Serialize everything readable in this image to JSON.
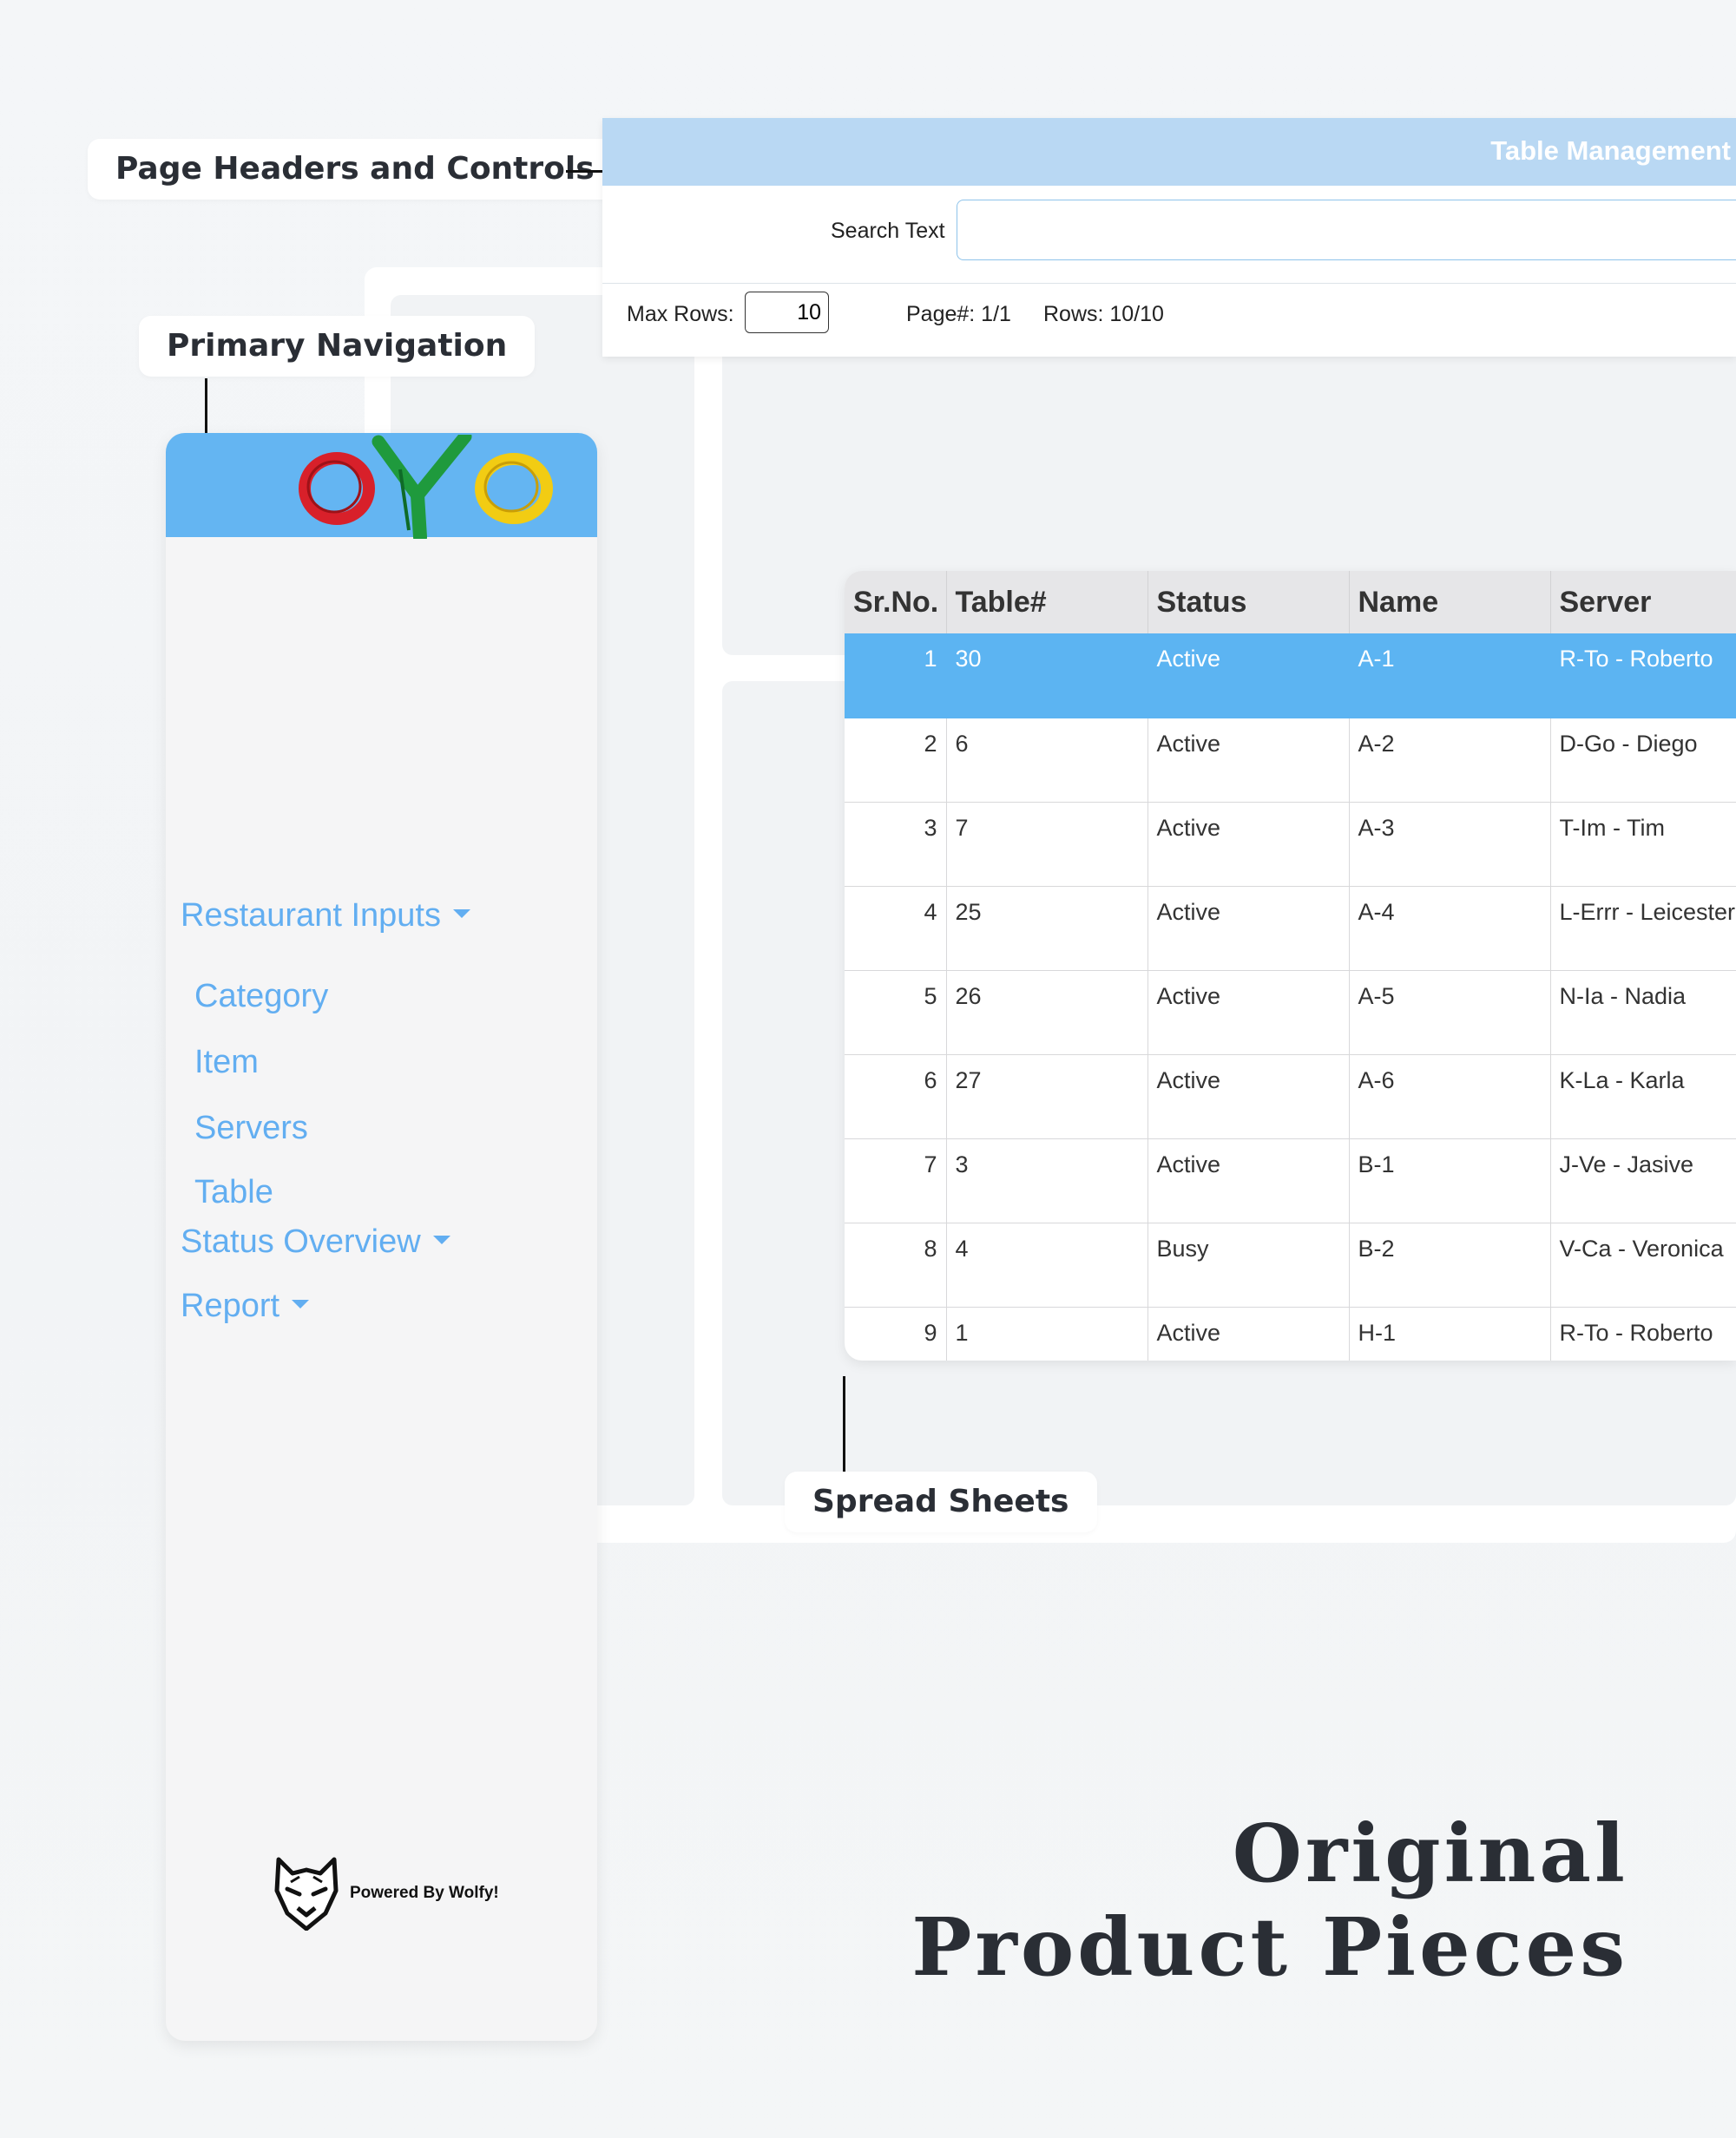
{
  "callouts": {
    "headers": "Page Headers and Controls",
    "navigation": "Primary Navigation",
    "spreadsheets": "Spread Sheets"
  },
  "sidebar": {
    "brand": "oyo",
    "menu": {
      "restaurant_inputs": "Restaurant Inputs",
      "items": [
        "Category",
        "Item",
        "Servers",
        "Table"
      ],
      "status_overview": "Status Overview",
      "report": "Report"
    },
    "footer": "Powered By Wolfy!"
  },
  "header": {
    "title": "Table Management",
    "search_label": "Search Text",
    "search_value": "",
    "max_rows_label": "Max Rows:",
    "max_rows_value": "10",
    "page_info": "Page#: 1/1",
    "rows_info": "Rows: 10/10"
  },
  "grid": {
    "columns": [
      "Sr.No.",
      "Table#",
      "Status",
      "Name",
      "Server"
    ],
    "rows": [
      [
        "1",
        "30",
        "Active",
        "A-1",
        "R-To - Roberto"
      ],
      [
        "2",
        "6",
        "Active",
        "A-2",
        "D-Go - Diego"
      ],
      [
        "3",
        "7",
        "Active",
        "A-3",
        "T-Im - Tim"
      ],
      [
        "4",
        "25",
        "Active",
        "A-4",
        "L-Errr - Leicester"
      ],
      [
        "5",
        "26",
        "Active",
        "A-5",
        "N-Ia - Nadia"
      ],
      [
        "6",
        "27",
        "Active",
        "A-6",
        "K-La - Karla"
      ],
      [
        "7",
        "3",
        "Active",
        "B-1",
        "J-Ve - Jasive"
      ],
      [
        "8",
        "4",
        "Busy",
        "B-2",
        "V-Ca - Veronica"
      ],
      [
        "9",
        "1",
        "Active",
        "H-1",
        "R-To - Roberto"
      ]
    ],
    "selected_row": 0
  },
  "tagline": {
    "line1": "Original",
    "line2": "Product Pieces"
  },
  "colors": {
    "accent_blue": "#5cb4f2",
    "header_bar": "#b9d8f3",
    "link_blue": "#62aef1",
    "dark_text": "#2a2e35"
  }
}
